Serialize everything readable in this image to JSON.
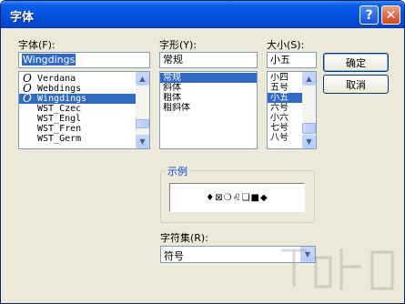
{
  "window": {
    "title": "字体"
  },
  "font": {
    "label": "字体(F):",
    "value": "Wingdings",
    "items": [
      {
        "name": "Verdana",
        "icon": "O",
        "selected": false
      },
      {
        "name": "Webdings",
        "icon": "O",
        "selected": false
      },
      {
        "name": "Wingdings",
        "icon": "O",
        "selected": true
      },
      {
        "name": "WST_Czec",
        "icon": "",
        "selected": false
      },
      {
        "name": "WST_Engl",
        "icon": "",
        "selected": false
      },
      {
        "name": "WST_Fren",
        "icon": "",
        "selected": false
      },
      {
        "name": "WST_Germ",
        "icon": "",
        "selected": false
      }
    ]
  },
  "style": {
    "label": "字形(Y):",
    "value": "常规",
    "items": [
      {
        "name": "常规",
        "selected": true
      },
      {
        "name": "斜体",
        "selected": false
      },
      {
        "name": "粗体",
        "selected": false
      },
      {
        "name": "粗斜体",
        "selected": false
      }
    ]
  },
  "size": {
    "label": "大小(S):",
    "value": "小五",
    "items": [
      {
        "name": "小四",
        "selected": false
      },
      {
        "name": "五号",
        "selected": false
      },
      {
        "name": "小五",
        "selected": true
      },
      {
        "name": "六号",
        "selected": false
      },
      {
        "name": "小六",
        "selected": false
      },
      {
        "name": "七号",
        "selected": false
      },
      {
        "name": "八号",
        "selected": false
      }
    ]
  },
  "buttons": {
    "ok": "确定",
    "cancel": "取消"
  },
  "sample": {
    "label": "示例",
    "text": "♦⊠❍♌❏■◆"
  },
  "charset": {
    "label": "字符集(R):",
    "value": "符号"
  },
  "icons": {
    "help": "help-icon",
    "close": "close-icon",
    "scroll_up": "arrow-up-icon",
    "scroll_down": "arrow-down-icon",
    "dropdown": "chevron-down-icon"
  }
}
